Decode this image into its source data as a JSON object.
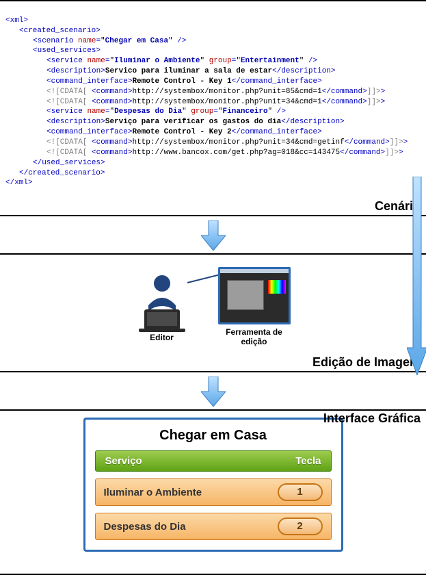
{
  "xml": {
    "root_open": "<xml>",
    "root_close": "</xml>",
    "created_open": "<created_scenario>",
    "created_close": "</created_scenario>",
    "scenario_tag": "scenario",
    "scenario_name_attr": "name",
    "scenario_name_val": "Chegar em Casa",
    "used_open": "<used_services>",
    "used_close": "</used_services>",
    "service_tag": "service",
    "name_attr": "name",
    "group_attr": "group",
    "desc_tag": "description",
    "cmdif_tag": "command_interface",
    "cdata_open": "<![CDATA[",
    "cdata_close": "]]>",
    "cmd_tag": "command",
    "svc1_name": "Iluminar o Ambiente",
    "svc1_group": "Entertainment",
    "svc1_desc": "Servico para iluminar a sala de estar",
    "svc1_cmdif": "Remote Control - Key 1",
    "svc1_cmd1": "http://systembox/monitor.php?unit=85&cmd=1",
    "svc1_cmd2": "http://systembox/monitor.php?unit=34&cmd=1",
    "svc2_name": "Despesas do Dia",
    "svc2_group": "Financeiro",
    "svc2_desc": "Serviço para verificar os gastos do dia",
    "svc2_cmdif": "Remote Control - Key 2",
    "svc2_cmd1": "http://systembox/monitor.php?unit=34&cmd=getinf",
    "svc2_cmd2": "http://www.bancox.com/get.php?ag=018&cc=143475"
  },
  "labels": {
    "cenario": "Cenário",
    "edicao": "Edição de Imagem",
    "interface": "Interface Gráfica",
    "editor": "Editor",
    "ferramenta": "Ferramenta de edição"
  },
  "gui": {
    "title": "Chegar em Casa",
    "col_service": "Serviço",
    "col_key": "Tecla",
    "rows": [
      {
        "service": "Iluminar o Ambiente",
        "key": "1"
      },
      {
        "service": "Despesas do Dia",
        "key": "2"
      }
    ]
  }
}
